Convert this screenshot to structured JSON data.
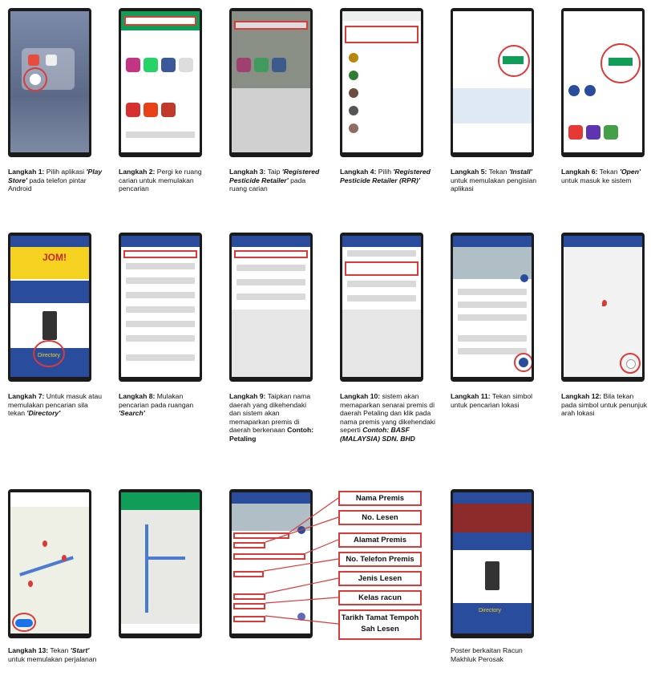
{
  "steps": [
    {
      "title": "Langkah 1:",
      "text_a": " Pilih aplikasi ",
      "em": "'Play Store'",
      "text_b": " pada telefon pintar Android"
    },
    {
      "title": "Langkah 2:",
      "text_a": " Pergi ke ruang carian untuk memulakan pencarian",
      "em": "",
      "text_b": ""
    },
    {
      "title": "Langkah 3:",
      "text_a": " Taip ",
      "em": "'Registered Pesticide Retailer'",
      "text_b": " pada ruang carian"
    },
    {
      "title": "Langkah 4:",
      "text_a": " Pilih ",
      "em": "'Registered Pesticide Retailer (RPR)'",
      "text_b": ""
    },
    {
      "title": "Langkah 5:",
      "text_a": " Tekan ",
      "em": "'Install'",
      "text_b": " untuk memulakan pengisian aplikasi"
    },
    {
      "title": "Langkah 6:",
      "text_a": " Tekan ",
      "em": "'Open'",
      "text_b": " untuk masuk ke sistem"
    },
    {
      "title": "Langkah 7:",
      "text_a": " Untuk masuk atau memulakan pencarian sila tekan ",
      "em": "'Directory'",
      "text_b": ""
    },
    {
      "title": "Langkah 8:",
      "text_a": " Mulakan pencarian pada ruangan ",
      "em": "'Search'",
      "text_b": ""
    },
    {
      "title": "Langkah 9:",
      "text_a": " Taipkan nama daerah yang dikehendaki dan sistem akan memaparkan premis di daerah berkenaan ",
      "em": "",
      "text_b": "",
      "bold_tail": "Contoh: Petaling"
    },
    {
      "title": "Langkah 10:",
      "text_a": " sistem akan memaparkan senarai premis di daerah Petaling dan klik pada nama premis yang dikehendaki seperti ",
      "em": "Contoh: BASF (MALAYSIA) SDN. BHD",
      "text_b": ""
    },
    {
      "title": "Langkah 11:",
      "text_a": " Tekan simbol untuk pencarian lokasi",
      "em": "",
      "text_b": ""
    },
    {
      "title": "Langkah 12:",
      "text_a": " Bila tekan pada simbol untuk penunjuk arah lokasi",
      "em": "",
      "text_b": ""
    },
    {
      "title": "Langkah 13:",
      "text_a": " Tekan ",
      "em": "'Start'",
      "text_b": " untuk memulakan perjalanan"
    }
  ],
  "poster_caption": "Poster berkaitan Racun Makhluk Perosak",
  "labels": [
    "Nama Premis",
    "No. Lesen",
    "Alamat Premis",
    "No. Telefon Premis",
    "Jenis Lesen",
    "Kelas racun",
    "Tarikh Tamat Tempoh Sah Lesen"
  ],
  "screen_text": {
    "directory_button": "Directory",
    "jom_banner": "JOM!"
  },
  "colors": {
    "accent_red": "#d93a3a",
    "app_blue": "#2a4c9c",
    "play_green": "#0f9d58"
  }
}
